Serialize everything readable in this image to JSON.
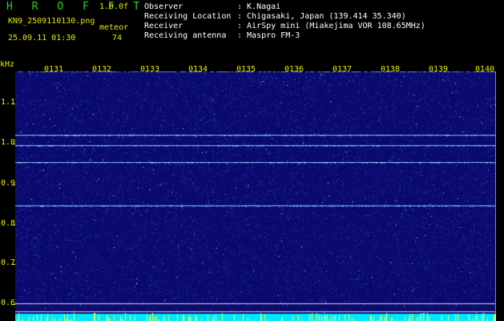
{
  "header": {
    "brand": "H R O F F T",
    "version": "1.0.0f",
    "filename": "KN9_2509110130.png",
    "mode": "meteor",
    "datetime": "25.09.11 01:30",
    "count": "74",
    "fields": [
      {
        "key": "Observer",
        "value": ": K.Nagai"
      },
      {
        "key": "Receiving Location",
        "value": ": Chigasaki, Japan (139.414 35.340)"
      },
      {
        "key": "Receiver",
        "value": ": AirSpy mini (Miakejima VOR 108.65MHz)"
      },
      {
        "key": "Receiving antenna",
        "value": ": Maspro FM-3"
      }
    ]
  },
  "axis": {
    "y_unit": "kHz",
    "y_labels": [
      "1.1",
      "1.0",
      "0.9",
      "0.8",
      "0.7",
      "0.6"
    ],
    "time_labels": [
      "0131",
      "0132",
      "0133",
      "0134",
      "0135",
      "0136",
      "0137",
      "0138",
      "0139",
      "0140"
    ]
  },
  "colors": {
    "background": "#000000",
    "plot_bg": "#0a0a6e",
    "label_yellow": "#e8e800",
    "brand_green": "#28d228",
    "signal_line": "#7ab8ff"
  },
  "spectrogram": {
    "y_range_khz": [
      0.595,
      1.185
    ],
    "signal_lines_khz": [
      1.03,
      1.005,
      0.965,
      0.858
    ],
    "reference_lines_khz": [
      0.62,
      0.6
    ]
  }
}
